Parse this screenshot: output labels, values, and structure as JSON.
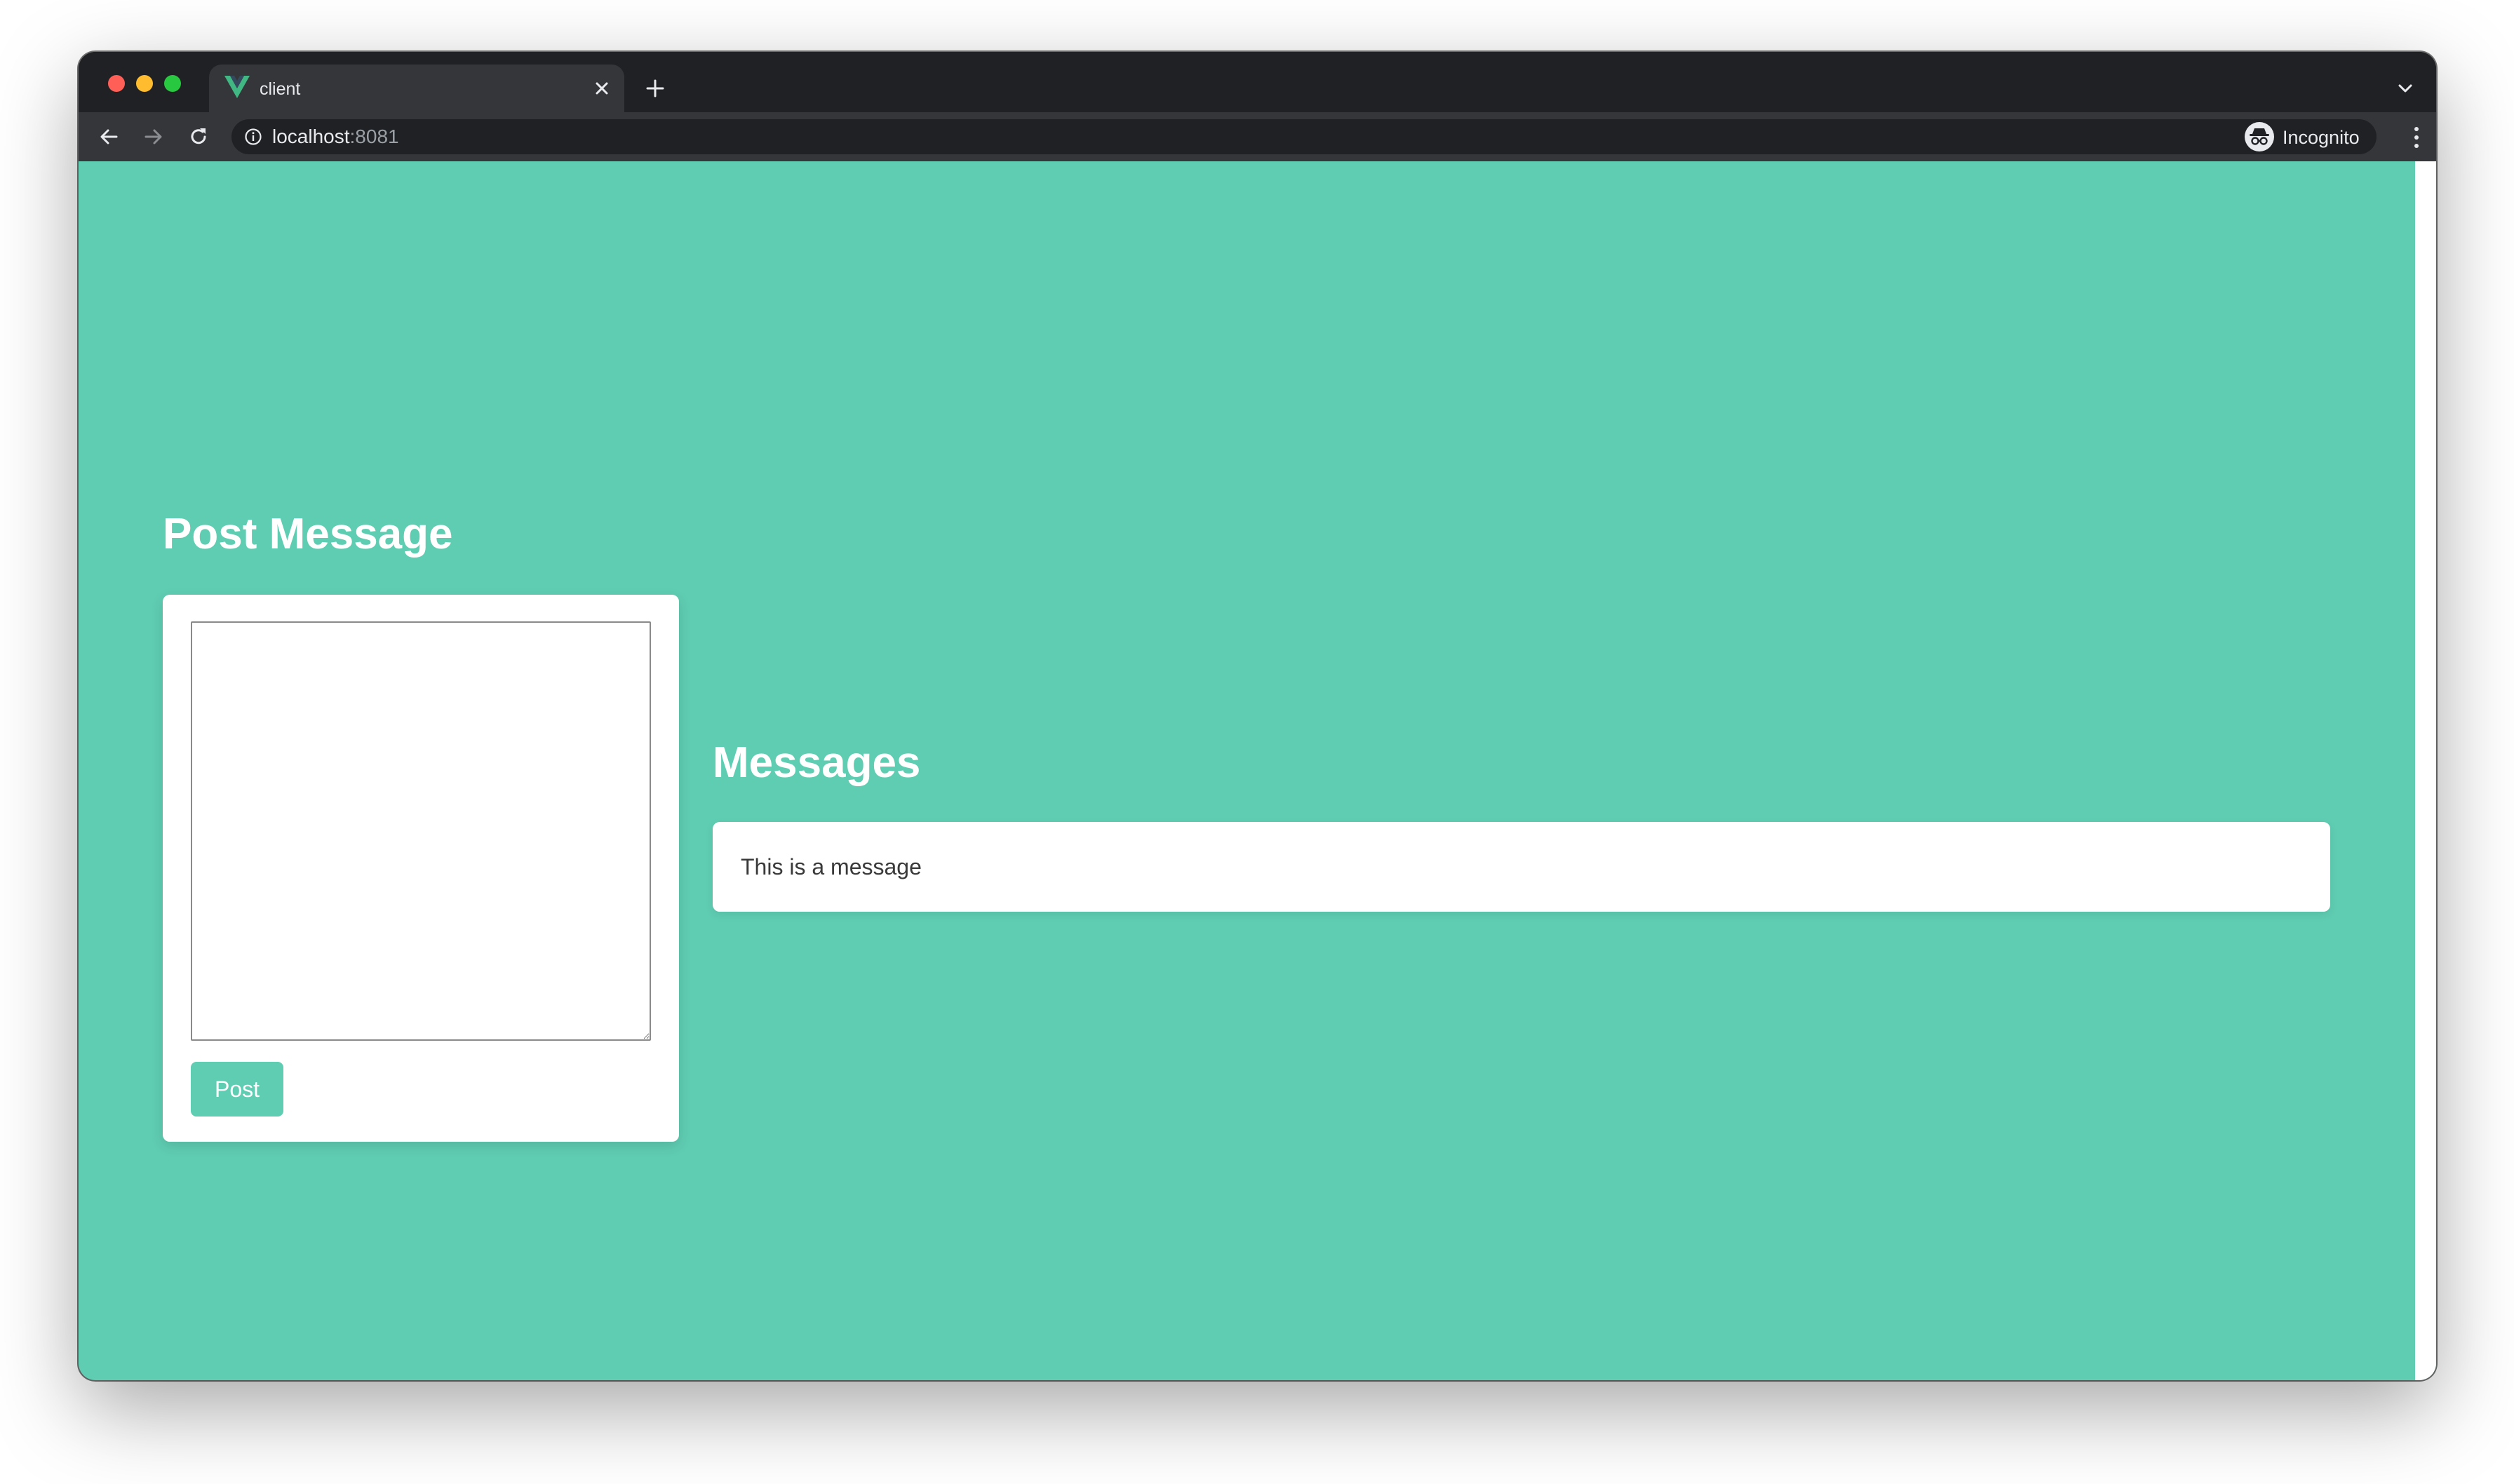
{
  "browser": {
    "tab": {
      "title": "client",
      "favicon": "vue-logo-icon"
    },
    "address": {
      "host": "localhost",
      "port": ":8081"
    },
    "profile": {
      "label": "Incognito",
      "icon": "incognito-icon"
    },
    "icons": {
      "close_tab": "close-icon",
      "new_tab": "plus-icon",
      "tab_overflow": "chevron-down-icon",
      "back": "arrow-left-icon",
      "forward": "arrow-right-icon",
      "reload": "reload-icon",
      "site_info": "info-icon",
      "bookmark": "star-icon",
      "menu": "kebab-menu-icon"
    }
  },
  "page": {
    "post_section": {
      "heading": "Post Message",
      "textarea_value": "",
      "button_label": "Post"
    },
    "messages_section": {
      "heading": "Messages",
      "messages": [
        {
          "text": "This is a message"
        }
      ]
    }
  },
  "colors": {
    "background": "#5fcdb2",
    "accent": "#5fcdb2",
    "card": "#ffffff",
    "heading_text": "#ffffff",
    "browser_frame": "#202124",
    "browser_toolbar": "#35363a"
  }
}
